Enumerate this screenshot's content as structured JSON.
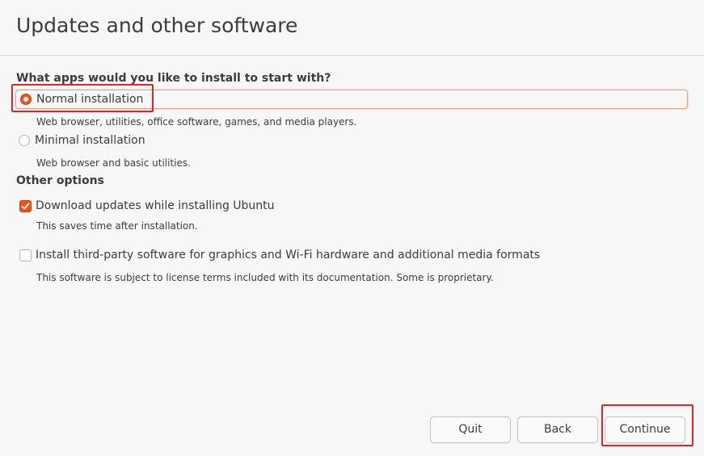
{
  "window": {
    "title": "Updates and other software"
  },
  "apps_section": {
    "heading": "What apps would you like to install to start with?",
    "options": [
      {
        "label": "Normal installation",
        "description": "Web browser, utilities, office software, games, and media players.",
        "selected": true
      },
      {
        "label": "Minimal installation",
        "description": "Web browser and basic utilities.",
        "selected": false
      }
    ]
  },
  "other_section": {
    "heading": "Other options",
    "options": [
      {
        "label": "Download updates while installing Ubuntu",
        "description": "This saves time after installation.",
        "checked": true
      },
      {
        "label": "Install third-party software for graphics and Wi-Fi hardware and additional media formats",
        "description": "This software is subject to license terms included with its documentation. Some is proprietary.",
        "checked": false
      }
    ]
  },
  "buttons": {
    "quit": "Quit",
    "back": "Back",
    "continue": "Continue"
  },
  "colors": {
    "accent": "#e95420",
    "annotation": "#e0242a",
    "background": "#f7f7f7",
    "text": "#3c3c3c"
  }
}
